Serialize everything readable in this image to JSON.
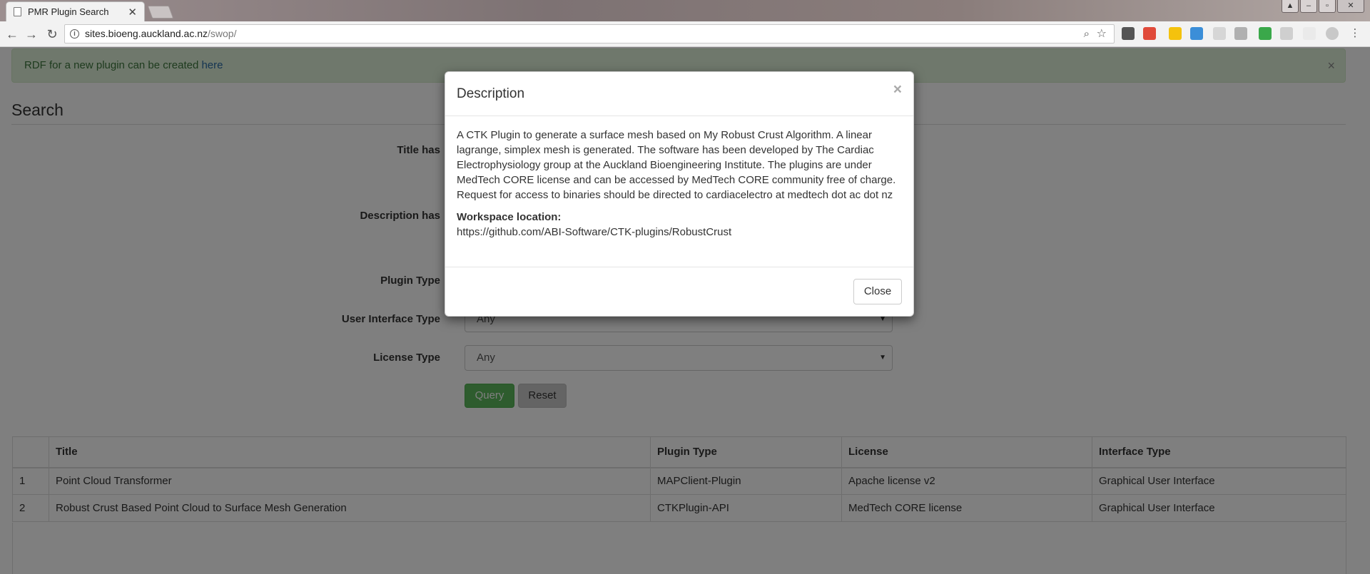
{
  "browser": {
    "tab_title": "PMR Plugin Search",
    "url_host": "sites.bioeng.auckland.ac.nz",
    "url_path": "/swop/"
  },
  "alert": {
    "text": "RDF for a new plugin can be created ",
    "link": "here",
    "close": "×"
  },
  "search": {
    "heading": "Search",
    "fields": {
      "title_label": "Title has",
      "description_label": "Description has",
      "plugin_type_label": "Plugin Type",
      "ui_type_label": "User Interface Type",
      "ui_type_value": "Any",
      "license_type_label": "License Type",
      "license_type_value": "Any"
    },
    "query_button": "Query",
    "reset_button": "Reset"
  },
  "table": {
    "columns": [
      "",
      "Title",
      "Plugin Type",
      "License",
      "Interface Type"
    ],
    "rows": [
      [
        "1",
        "Point Cloud Transformer",
        "MAPClient-Plugin",
        "Apache license v2",
        "Graphical User Interface"
      ],
      [
        "2",
        "Robust Crust Based Point Cloud to Surface Mesh Generation",
        "CTKPlugin-API",
        "MedTech CORE license",
        "Graphical User Interface"
      ]
    ]
  },
  "modal": {
    "title": "Description",
    "close_x": "×",
    "description": "A CTK Plugin to generate a surface mesh based on My Robust Crust Algorithm. A linear lagrange, simplex mesh is generated. The software has been developed by The Cardiac Electrophysiology group at the Auckland Bioengineering Institute. The plugins are under MedTech CORE license and can be accessed by MedTech CORE community free of charge. Request for access to binaries should be directed to cardiacelectro at medtech dot ac dot nz",
    "workspace_label": "Workspace location:",
    "workspace_url": "https://github.com/ABI-Software/CTK-plugins/RobustCrust",
    "close_button": "Close"
  },
  "colors": {
    "alert_bg": "#dff0d8",
    "query_green": "#5cb85c",
    "link_blue": "#2a6aa5"
  }
}
